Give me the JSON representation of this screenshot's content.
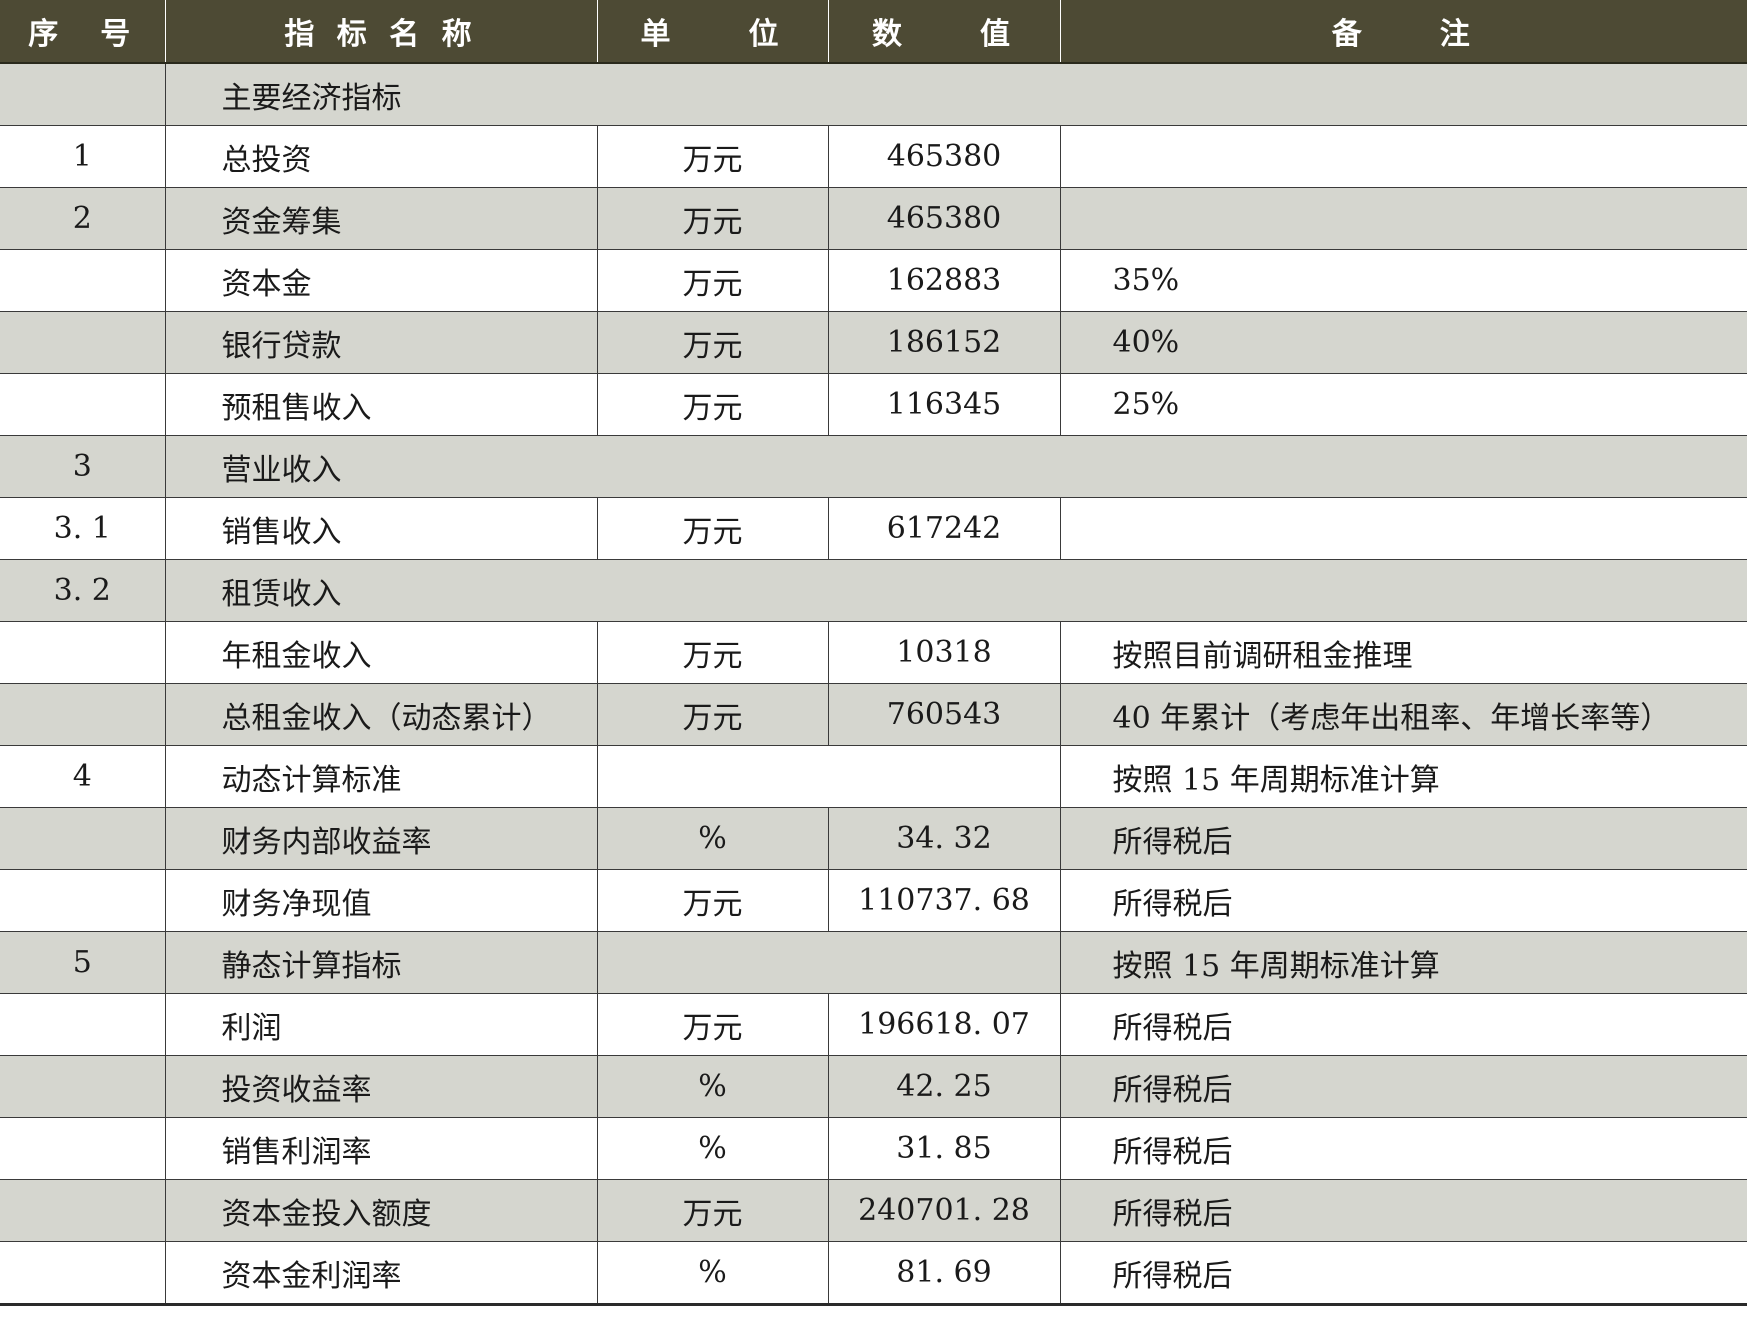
{
  "headers": [
    "序　号",
    "指 标 名 称",
    "单　　位",
    "数　　值",
    "备　　注"
  ],
  "rows": [
    {
      "no": "",
      "name": "主要经济指标",
      "unit": "",
      "value": "",
      "note": "",
      "span": "name"
    },
    {
      "no": "1",
      "name": "总投资",
      "unit": "万元",
      "value": "465380",
      "note": ""
    },
    {
      "no": "2",
      "name": "资金筹集",
      "unit": "万元",
      "value": "465380",
      "note": ""
    },
    {
      "no": "",
      "name": "资本金",
      "unit": "万元",
      "value": "162883",
      "note": "35%"
    },
    {
      "no": "",
      "name": "银行贷款",
      "unit": "万元",
      "value": "186152",
      "note": "40%"
    },
    {
      "no": "",
      "name": "预租售收入",
      "unit": "万元",
      "value": "116345",
      "note": "25%"
    },
    {
      "no": "3",
      "name": "营业收入",
      "unit": "",
      "value": "",
      "note": "",
      "span": "name"
    },
    {
      "no": "3. 1",
      "name": "销售收入",
      "unit": "万元",
      "value": "617242",
      "note": ""
    },
    {
      "no": "3. 2",
      "name": "租赁收入",
      "unit": "",
      "value": "",
      "note": "",
      "span": "name"
    },
    {
      "no": "",
      "name": "年租金收入",
      "unit": "万元",
      "value": "10318",
      "note": "按照目前调研租金推理"
    },
    {
      "no": "",
      "name": "总租金收入（动态累计）",
      "unit": "万元",
      "value": "760543",
      "note": "40 年累计（考虑年出租率、年增长率等）"
    },
    {
      "no": "4",
      "name": "动态计算标准",
      "unit": "",
      "value": "",
      "note": "按照 15 年周期标准计算",
      "span": "unitvalue"
    },
    {
      "no": "",
      "name": "财务内部收益率",
      "unit": "%",
      "value": "34. 32",
      "note": "所得税后"
    },
    {
      "no": "",
      "name": "财务净现值",
      "unit": "万元",
      "value": "110737. 68",
      "note": "所得税后"
    },
    {
      "no": "5",
      "name": "静态计算指标",
      "unit": "",
      "value": "",
      "note": "按照 15 年周期标准计算",
      "span": "unitvalue"
    },
    {
      "no": "",
      "name": "利润",
      "unit": "万元",
      "value": "196618. 07",
      "note": "所得税后"
    },
    {
      "no": "",
      "name": "投资收益率",
      "unit": "%",
      "value": "42. 25",
      "note": "所得税后"
    },
    {
      "no": "",
      "name": "销售利润率",
      "unit": "%",
      "value": "31. 85",
      "note": "所得税后"
    },
    {
      "no": "",
      "name": "资本金投入额度",
      "unit": "万元",
      "value": "240701. 28",
      "note": "所得税后"
    },
    {
      "no": "",
      "name": "资本金利润率",
      "unit": "%",
      "value": "81. 69",
      "note": "所得税后"
    }
  ]
}
